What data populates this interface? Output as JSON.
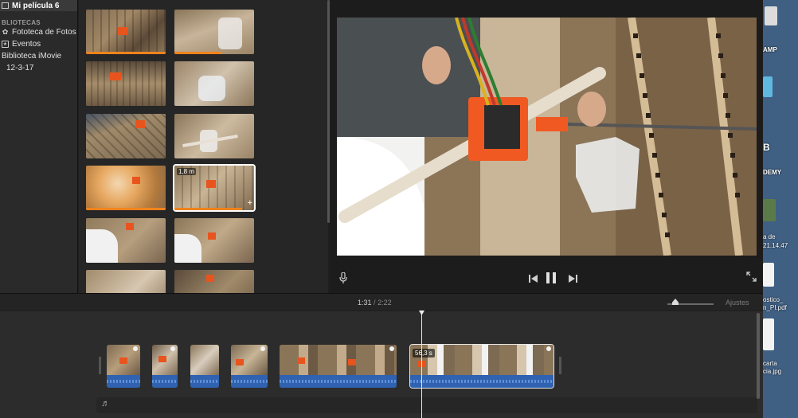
{
  "sidebar": {
    "project_title": "Mi película 6",
    "section_title": "BLIOTECAS",
    "items": [
      {
        "label": "Fototeca de Fotos",
        "icon": "photos-library-icon"
      },
      {
        "label": "Eventos",
        "icon": "star-events-icon"
      },
      {
        "label": "Biblioteca iMovie",
        "icon": ""
      },
      {
        "label": "12-3-17",
        "icon": ""
      }
    ]
  },
  "browser": {
    "selected_clip_duration": "1,8 m"
  },
  "timeline": {
    "current_time": "1:31",
    "separator": "/",
    "total_time": "2:22",
    "adjust_label": "Ajustes",
    "selected_clip_duration": "56,3 s",
    "music_icon": "♬"
  },
  "desktop": {
    "labels": [
      "AMP",
      "DEMY",
      "a de",
      "21.14.47",
      "ostico_",
      "n_PI.pdf",
      "carta",
      "cia.jpg",
      "B"
    ]
  },
  "colors": {
    "accent_orange": "#f0831c",
    "audio_blue": "#2f62b0",
    "background": "#1e1e1e"
  }
}
